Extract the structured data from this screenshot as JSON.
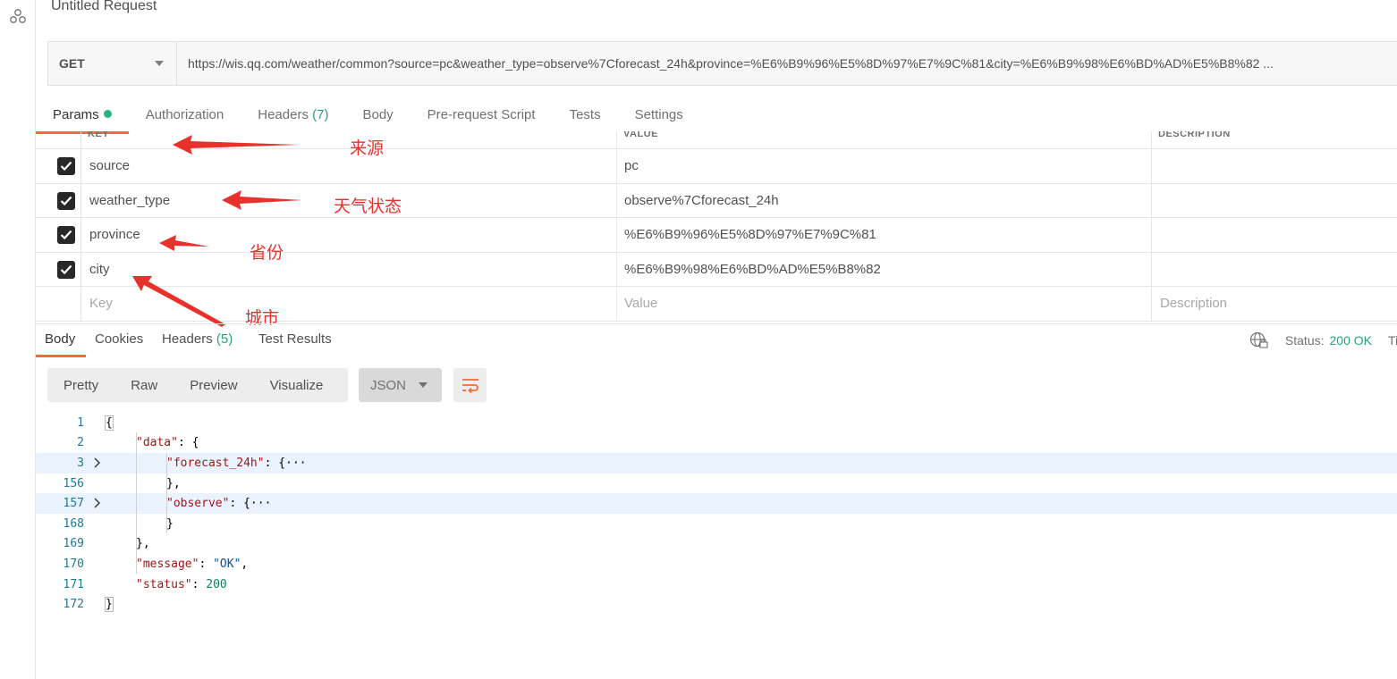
{
  "request": {
    "title": "Untitled Request",
    "method": "GET",
    "url": "https://wis.qq.com/weather/common?source=pc&weather_type=observe%7Cforecast_24h&province=%E6%B9%96%E5%8D%97%E7%9C%81&city=%E6%B9%98%E6%BD%AD%E5%B8%82 ..."
  },
  "request_tabs": [
    {
      "label": "Params",
      "active": true
    },
    {
      "label": "Authorization"
    },
    {
      "label": "Headers",
      "count": "(7)"
    },
    {
      "label": "Body"
    },
    {
      "label": "Pre-request Script"
    },
    {
      "label": "Tests"
    },
    {
      "label": "Settings"
    }
  ],
  "params": {
    "columns": [
      "KEY",
      "VALUE",
      "DESCRIPTION"
    ],
    "rows": [
      {
        "key": "source",
        "value": "pc",
        "checked": true
      },
      {
        "key": "weather_type",
        "value": "observe%7Cforecast_24h",
        "checked": true
      },
      {
        "key": "province",
        "value": "%E6%B9%96%E5%8D%97%E7%9C%81",
        "checked": true
      },
      {
        "key": "city",
        "value": "%E6%B9%98%E6%BD%AD%E5%B8%82",
        "checked": true
      }
    ],
    "placeholders": {
      "key": "Key",
      "value": "Value",
      "description": "Description"
    }
  },
  "annotations": {
    "source": "来源",
    "weather_type": "天气状态",
    "province": "省份",
    "city": "城市",
    "color": "#e8312b"
  },
  "response_tabs": [
    {
      "label": "Body",
      "active": true
    },
    {
      "label": "Cookies"
    },
    {
      "label": "Headers",
      "count": "(5)"
    },
    {
      "label": "Test Results"
    }
  ],
  "status": {
    "label": "Status:",
    "value": "200 OK",
    "truncated": "Ti"
  },
  "view_modes": [
    "Pretty",
    "Raw",
    "Preview",
    "Visualize"
  ],
  "format": "JSON",
  "code_lines": [
    {
      "num": "1",
      "text": "{"
    },
    {
      "num": "2",
      "text": "\"data\": {"
    },
    {
      "num": "3",
      "text": "\"forecast_24h\": {···"
    },
    {
      "num": "156",
      "text": "},"
    },
    {
      "num": "157",
      "text": "\"observe\": {···"
    },
    {
      "num": "168",
      "text": "}"
    },
    {
      "num": "169",
      "text": "},"
    },
    {
      "num": "170",
      "text": "\"message\": \"OK\","
    },
    {
      "num": "171",
      "text": "\"status\": 200"
    },
    {
      "num": "172",
      "text": "}"
    }
  ],
  "colors": {
    "accent": "#f26b3a",
    "success": "#26a17a",
    "highlight": "#eaf3fd"
  }
}
